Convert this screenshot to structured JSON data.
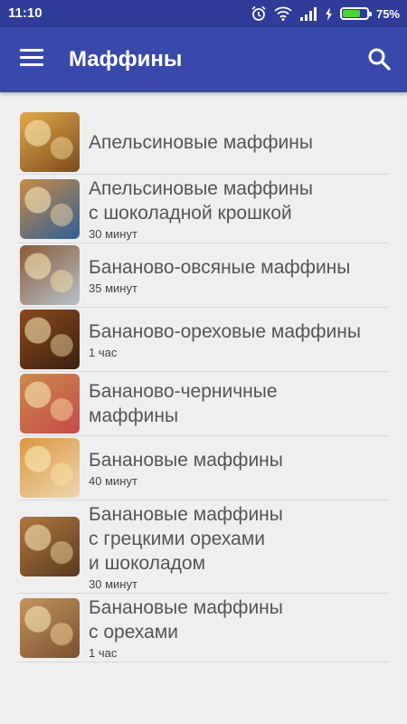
{
  "status_bar": {
    "time": "11:10",
    "battery_percent": "75%",
    "battery_level": 0.75,
    "icons": [
      "alarm-icon",
      "wifi-icon",
      "signal-icon",
      "charging-icon",
      "battery-icon"
    ]
  },
  "app_bar": {
    "title": "Маффины",
    "menu_icon": "menu-icon",
    "search_icon": "search-icon"
  },
  "recipes": [
    {
      "title": "Апельсиновые маффины",
      "time": "",
      "thumb": [
        "#e2a94a",
        "#7a4a1c"
      ]
    },
    {
      "title": "Апельсиновые маффины\nс шоколадной крошкой",
      "time": "30 минут",
      "thumb": [
        "#c98b45",
        "#2f5f97"
      ]
    },
    {
      "title": "Бананово-овсяные маффины",
      "time": "35 минут",
      "thumb": [
        "#8a5a36",
        "#b7c1cc"
      ]
    },
    {
      "title": "Бананово-ореховые маффины",
      "time": "1 час",
      "thumb": [
        "#8b4a1e",
        "#3a2010"
      ]
    },
    {
      "title": "Бананово-черничные\nмаффины",
      "time": "",
      "thumb": [
        "#c88a4e",
        "#c84a4a"
      ]
    },
    {
      "title": "Банановые маффины",
      "time": "40 минут",
      "thumb": [
        "#d9973f",
        "#f0d6b0"
      ]
    },
    {
      "title": "Банановые маффины\nс грецкими орехами\nи шоколадом",
      "time": "30 минут",
      "thumb": [
        "#b0773f",
        "#5a3a20"
      ]
    },
    {
      "title": "Банановые маффины\nс орехами",
      "time": "1 час",
      "thumb": [
        "#c2945e",
        "#7a5030"
      ]
    }
  ]
}
